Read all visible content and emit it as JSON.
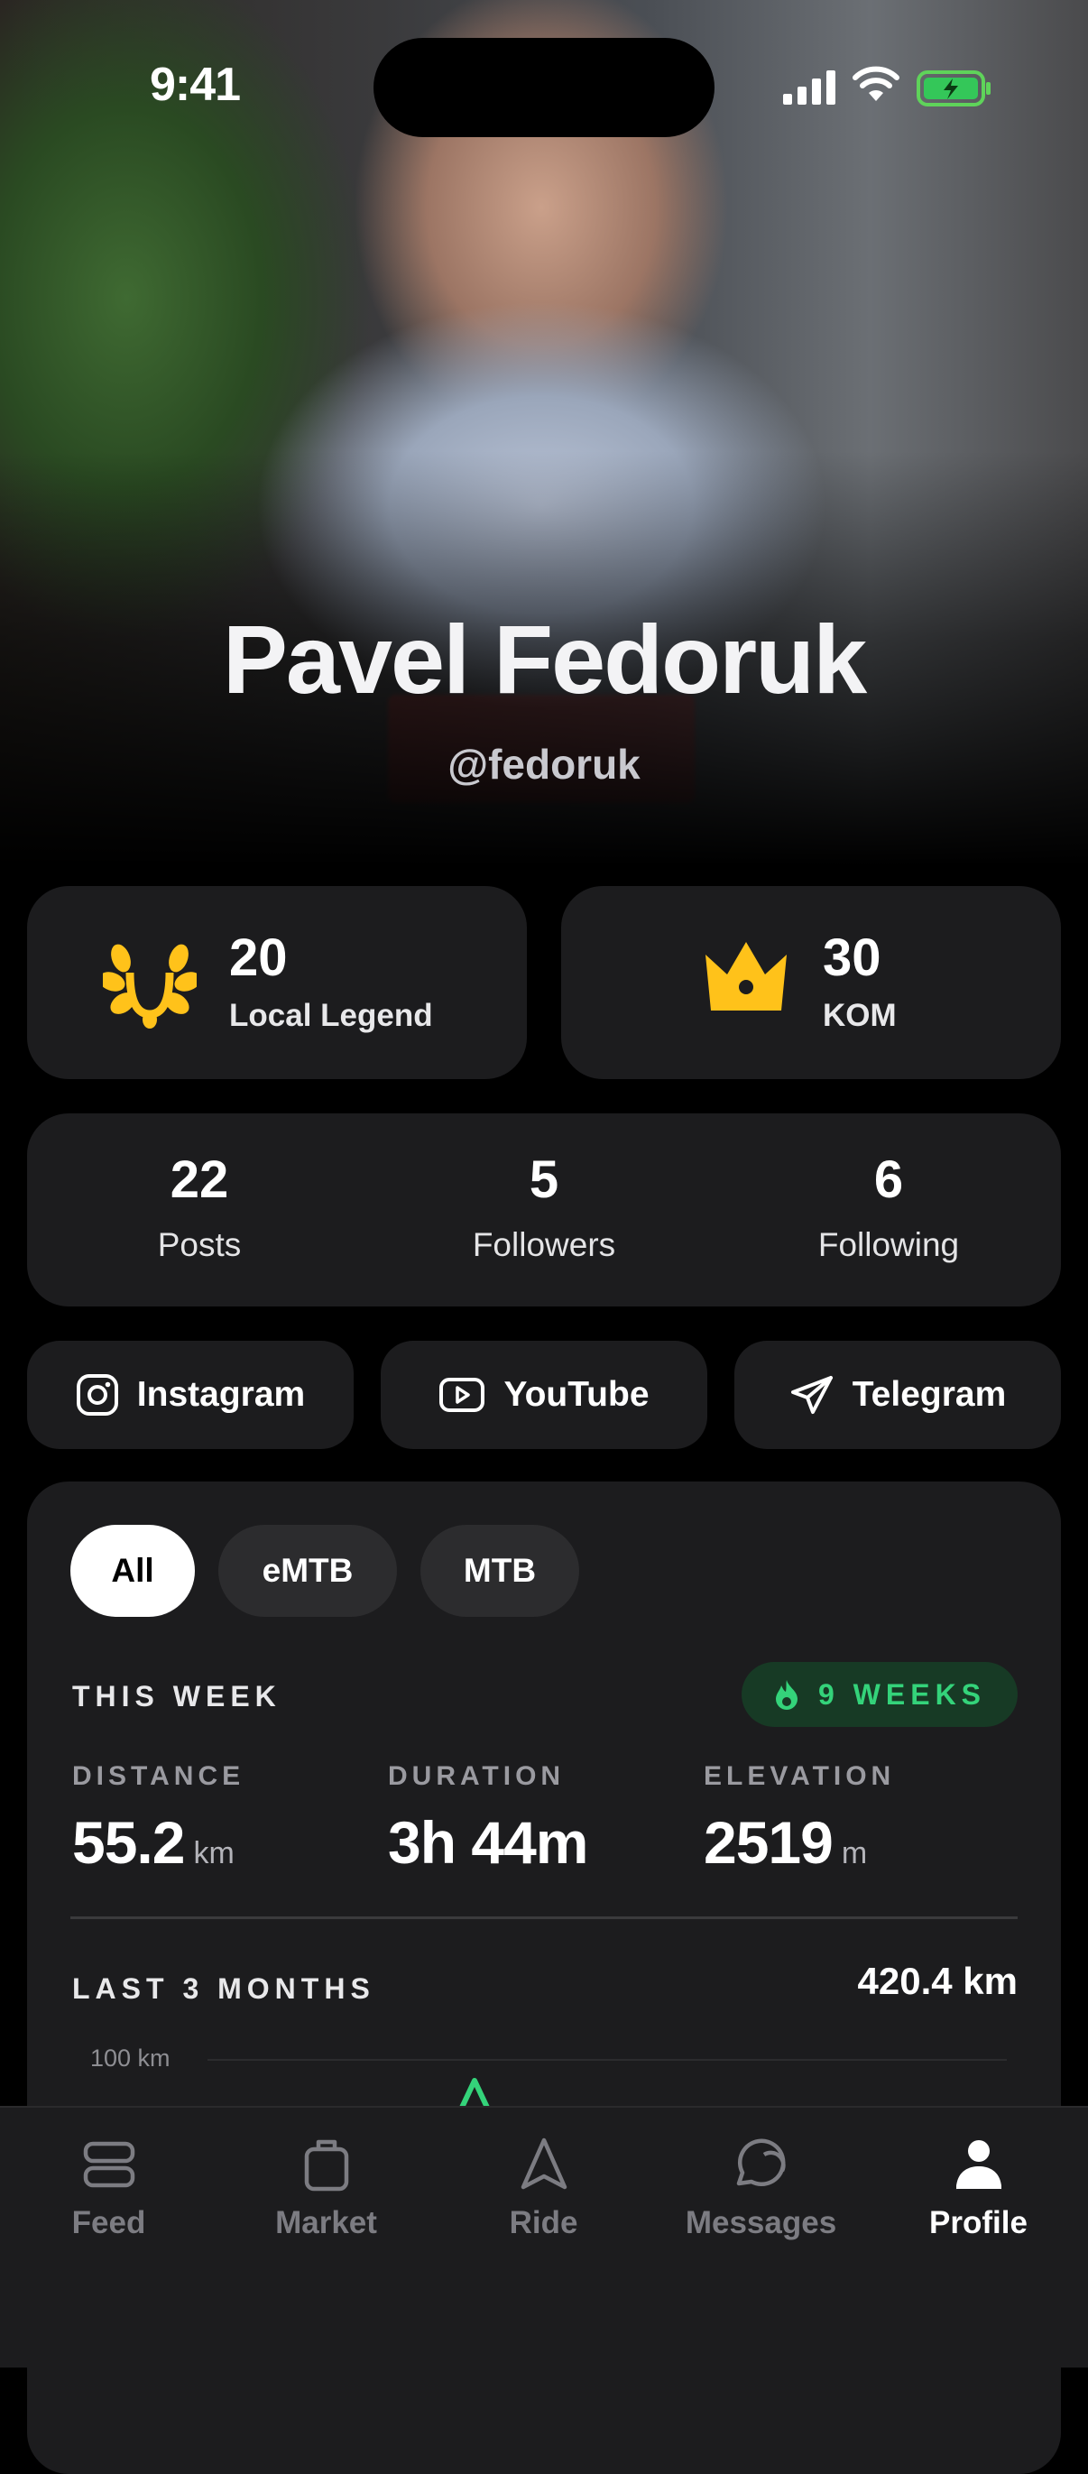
{
  "status_bar": {
    "time": "9:41"
  },
  "profile": {
    "name": "Pavel Fedoruk",
    "handle": "@fedoruk"
  },
  "awards": [
    {
      "icon": "laurel-icon",
      "count": "20",
      "label": "Local Legend",
      "color": "#FFC21A"
    },
    {
      "icon": "crown-icon",
      "count": "30",
      "label": "KOM",
      "color": "#FFC21A"
    }
  ],
  "stats": [
    {
      "value": "22",
      "label": "Posts"
    },
    {
      "value": "5",
      "label": "Followers"
    },
    {
      "value": "6",
      "label": "Following"
    }
  ],
  "social_links": [
    {
      "icon": "instagram-icon",
      "label": "Instagram"
    },
    {
      "icon": "youtube-icon",
      "label": "YouTube"
    },
    {
      "icon": "telegram-icon",
      "label": "Telegram"
    }
  ],
  "activity": {
    "filters": [
      "All",
      "eMTB",
      "MTB"
    ],
    "selected_filter": "All",
    "this_week": {
      "title": "THIS WEEK",
      "streak": {
        "icon": "flame-icon",
        "label": "9 WEEKS",
        "color": "#34D37A"
      },
      "metrics": [
        {
          "label": "DISTANCE",
          "value": "55.2",
          "unit": "km"
        },
        {
          "label": "DURATION",
          "value": "3h 44m",
          "unit": ""
        },
        {
          "label": "ELEVATION",
          "value": "2519",
          "unit": "m"
        }
      ]
    },
    "last_3_months": {
      "title": "LAST 3 MONTHS",
      "total": "420.4 km",
      "axis_label": "100 km"
    }
  },
  "tabbar": {
    "active": "Profile",
    "items": [
      {
        "icon": "feed-icon",
        "label": "Feed"
      },
      {
        "icon": "shopping-bag-icon",
        "label": "Market"
      },
      {
        "icon": "navigation-arrow-icon",
        "label": "Ride"
      },
      {
        "icon": "chat-bubble-icon",
        "label": "Messages"
      },
      {
        "icon": "person-icon",
        "label": "Profile"
      }
    ]
  },
  "colors": {
    "card": "#1C1C1E",
    "accent_gold": "#FFC21A",
    "accent_green": "#34D37A",
    "background": "#000000"
  }
}
